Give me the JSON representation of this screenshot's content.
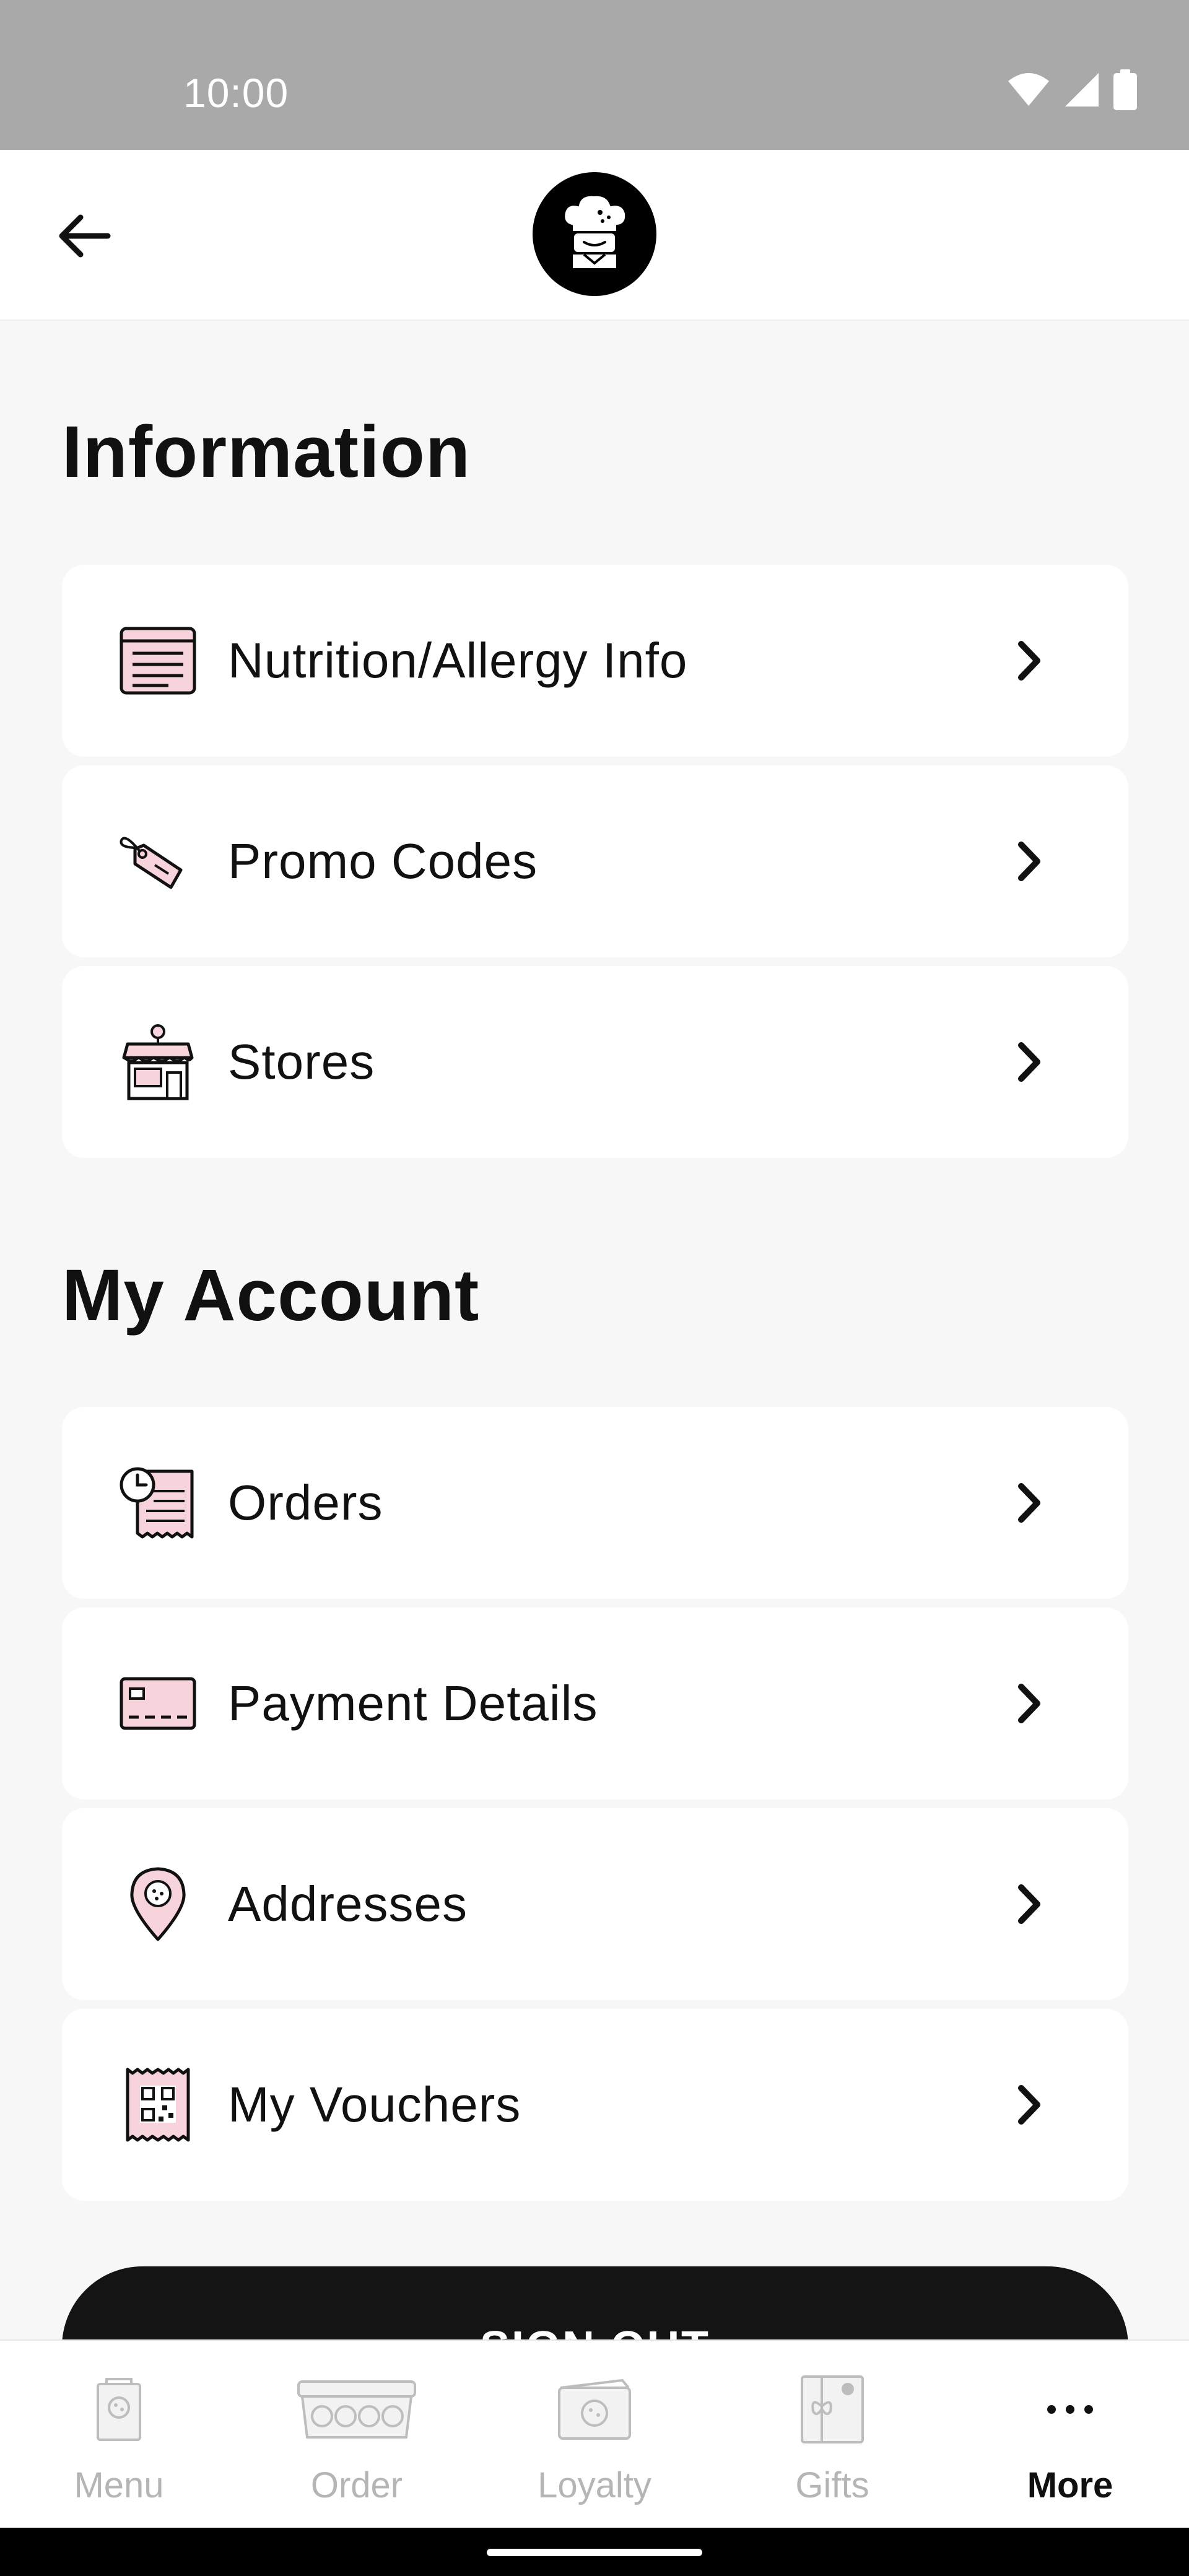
{
  "status_bar": {
    "time": "10:00"
  },
  "header": {
    "logo_icon": "chef-cookie-logo-icon",
    "back_icon": "arrow-left-icon"
  },
  "sections": {
    "information": {
      "title": "Information",
      "items": [
        {
          "label": "Nutrition/Allergy Info",
          "icon": "menu-list-icon"
        },
        {
          "label": "Promo Codes",
          "icon": "price-tag-icon"
        },
        {
          "label": "Stores",
          "icon": "storefront-icon"
        }
      ]
    },
    "my_account": {
      "title": "My Account",
      "items": [
        {
          "label": "Orders",
          "icon": "receipt-clock-icon"
        },
        {
          "label": "Payment Details",
          "icon": "credit-card-icon"
        },
        {
          "label": "Addresses",
          "icon": "map-pin-icon"
        },
        {
          "label": "My Vouchers",
          "icon": "qr-voucher-icon"
        }
      ]
    }
  },
  "signout": {
    "label": "SIGN OUT"
  },
  "tabs": [
    {
      "label": "Menu",
      "icon": "menu-card-icon",
      "active": false
    },
    {
      "label": "Order",
      "icon": "cookie-box-icon",
      "active": false
    },
    {
      "label": "Loyalty",
      "icon": "loyalty-card-icon",
      "active": false
    },
    {
      "label": "Gifts",
      "icon": "gift-card-icon",
      "active": false
    },
    {
      "label": "More",
      "icon": "more-dots-icon",
      "active": true
    }
  ],
  "colors": {
    "accent_pink": "#f7d3dc",
    "dark": "#141414",
    "background": "#f7f7f7"
  }
}
